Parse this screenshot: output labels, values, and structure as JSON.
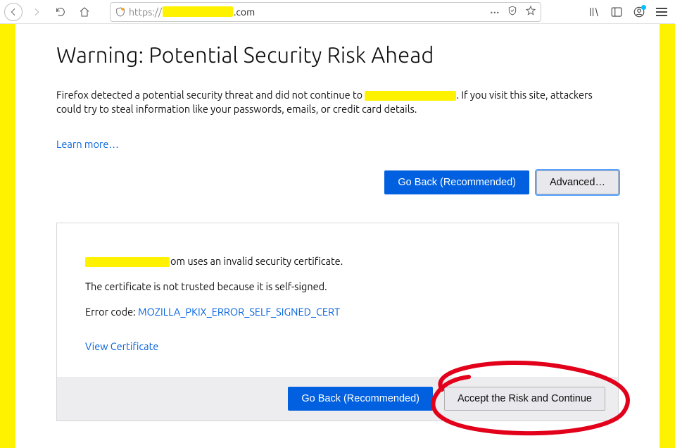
{
  "toolbar": {
    "url_prefix": "https://",
    "url_suffix": ".com",
    "ellipsis": "···"
  },
  "page": {
    "title": "Warning: Potential Security Risk Ahead",
    "body_part1": "Firefox detected a potential security threat and did not continue to ",
    "body_part2": ". If you visit this site, attackers could try to steal information like your passwords, emails, or credit card details.",
    "learn_more": "Learn more…",
    "go_back": "Go Back (Recommended)",
    "advanced": "Advanced…"
  },
  "details": {
    "line1_suffix": "om uses an invalid security certificate.",
    "line2": "The certificate is not trusted because it is self-signed.",
    "error_label": "Error code: ",
    "error_code": "MOZILLA_PKIX_ERROR_SELF_SIGNED_CERT",
    "view_certificate": "View Certificate",
    "go_back": "Go Back (Recommended)",
    "accept": "Accept the Risk and Continue"
  }
}
